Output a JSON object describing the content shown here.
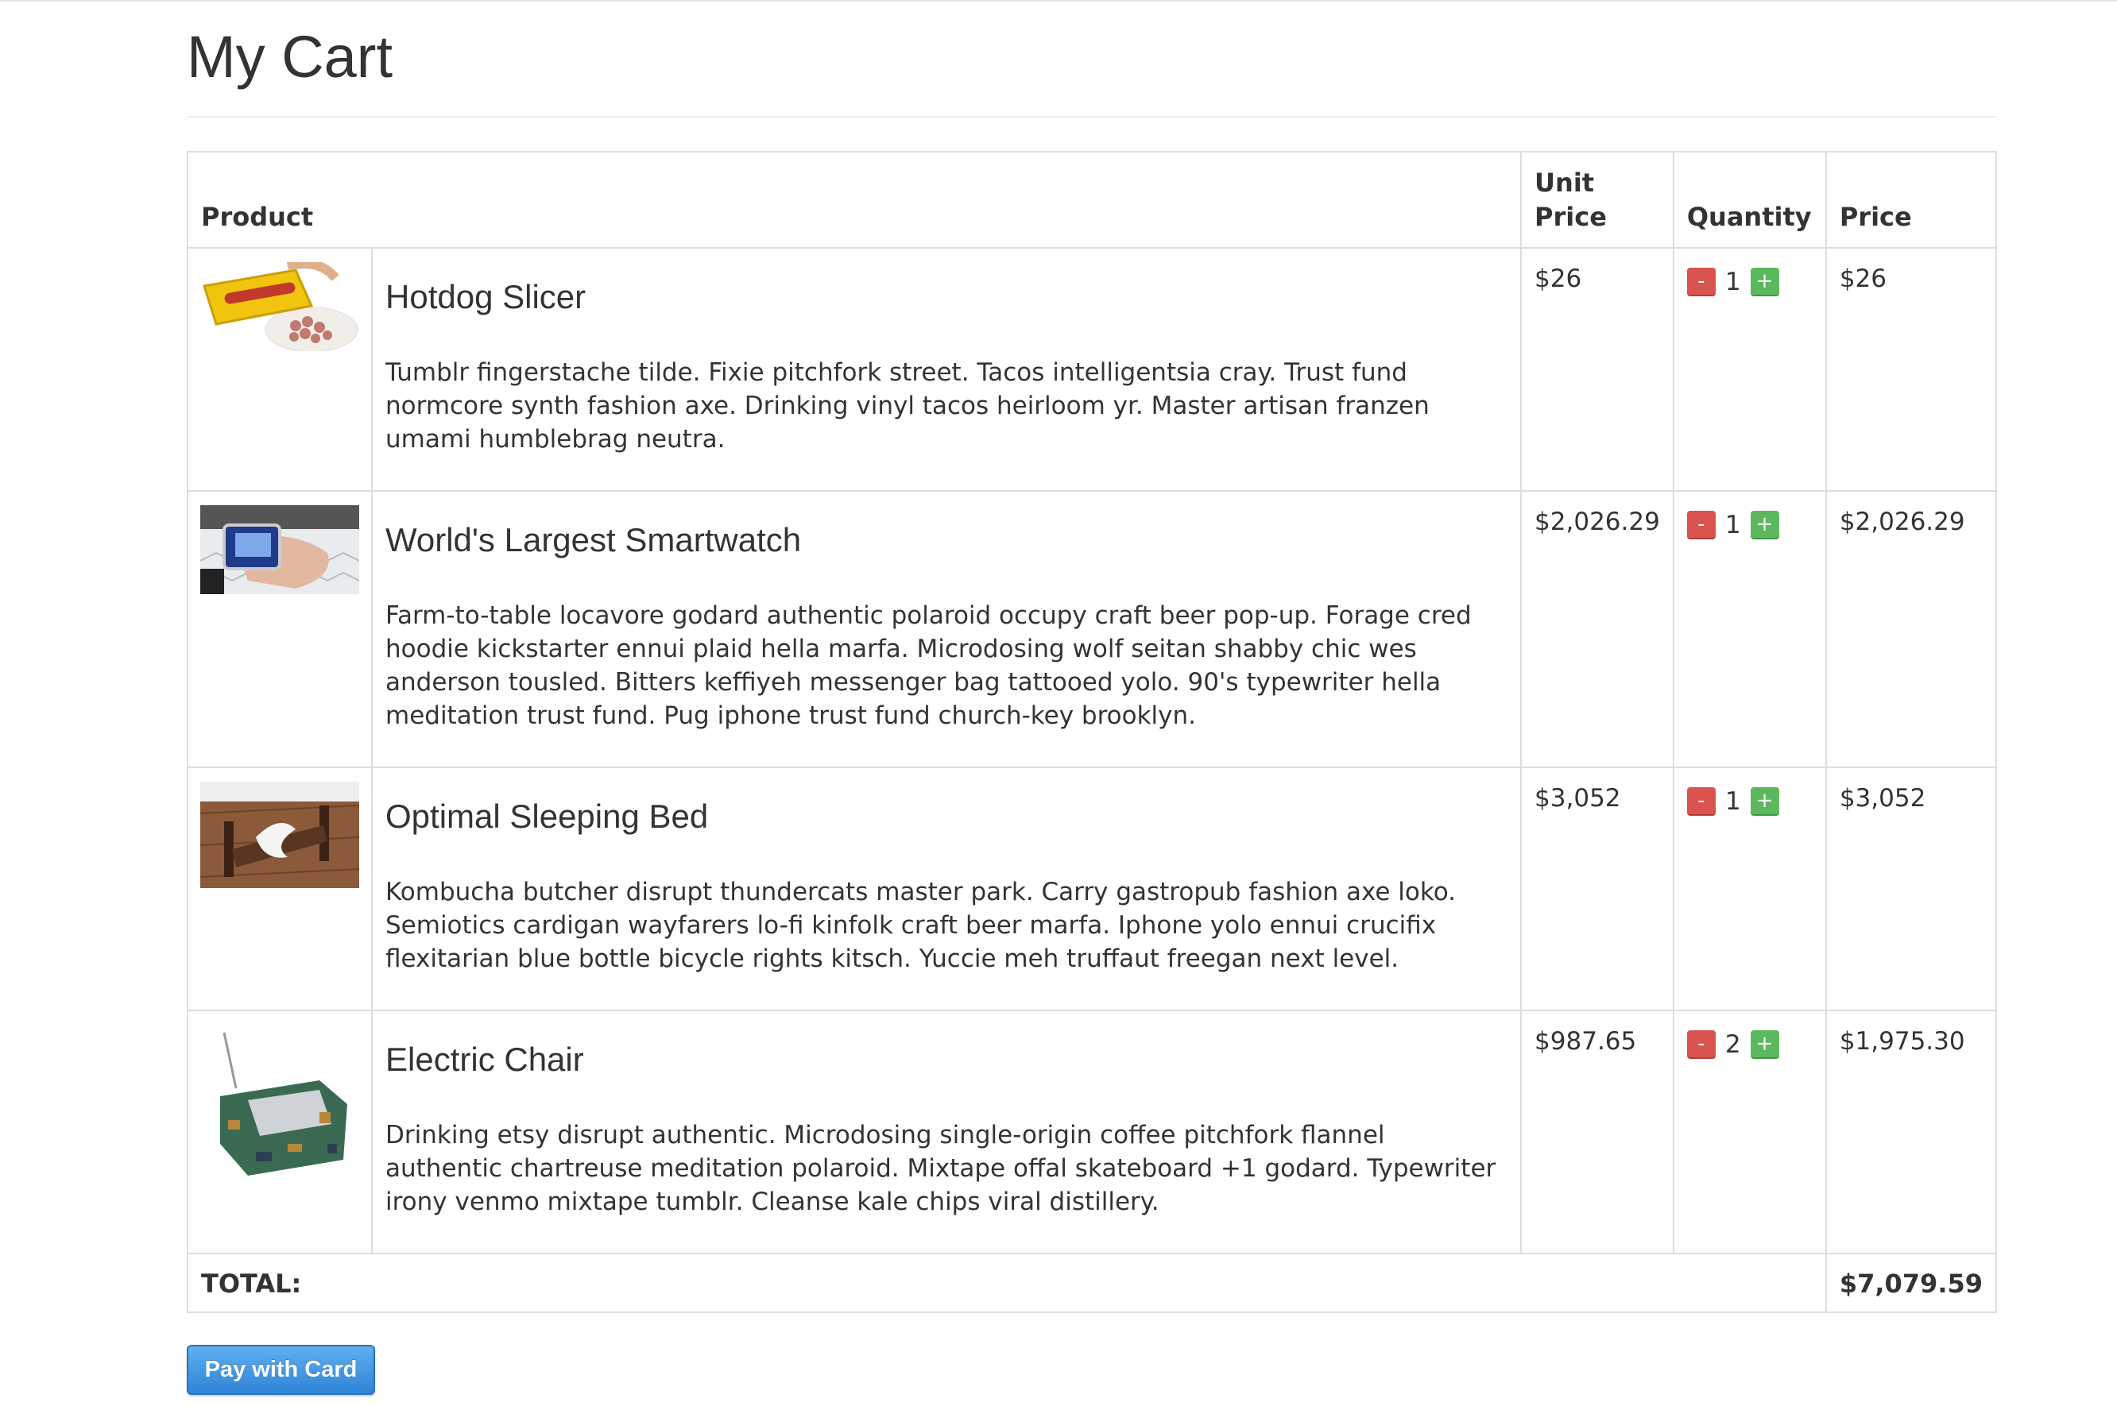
{
  "page": {
    "title": "My Cart"
  },
  "table": {
    "headers": {
      "product": "Product",
      "unit_price": "Unit Price",
      "quantity": "Quantity",
      "price": "Price"
    },
    "items": [
      {
        "name": "Hotdog Slicer",
        "description": "Tumblr fingerstache tilde. Fixie pitchfork street. Tacos intelligentsia cray. Trust fund normcore synth fashion axe. Drinking vinyl tacos heirloom yr. Master artisan franzen umami humblebrag neutra.",
        "unit_price": "$26",
        "quantity": "1",
        "price": "$26",
        "minus_label": "-",
        "plus_label": "+"
      },
      {
        "name": "World's Largest Smartwatch",
        "description": "Farm-to-table locavore godard authentic polaroid occupy craft beer pop-up. Forage cred hoodie kickstarter ennui plaid hella marfa. Microdosing wolf seitan shabby chic wes anderson tousled. Bitters keffiyeh messenger bag tattooed yolo. 90's typewriter hella meditation trust fund. Pug iphone trust fund church-key brooklyn.",
        "unit_price": "$2,026.29",
        "quantity": "1",
        "price": "$2,026.29",
        "minus_label": "-",
        "plus_label": "+"
      },
      {
        "name": "Optimal Sleeping Bed",
        "description": "Kombucha butcher disrupt thundercats master park. Carry gastropub fashion axe loko. Semiotics cardigan wayfarers lo-fi kinfolk craft beer marfa. Iphone yolo ennui crucifix flexitarian blue bottle bicycle rights kitsch. Yuccie meh truffaut freegan next level.",
        "unit_price": "$3,052",
        "quantity": "1",
        "price": "$3,052",
        "minus_label": "-",
        "plus_label": "+"
      },
      {
        "name": "Electric Chair",
        "description": "Drinking etsy disrupt authentic. Microdosing single-origin coffee pitchfork flannel authentic chartreuse meditation polaroid. Mixtape offal skateboard +1 godard. Typewriter irony venmo mixtape tumblr. Cleanse kale chips viral distillery.",
        "unit_price": "$987.65",
        "quantity": "2",
        "price": "$1,975.30",
        "minus_label": "-",
        "plus_label": "+"
      }
    ],
    "total_label": "TOTAL:",
    "total_value": "$7,079.59"
  },
  "actions": {
    "pay_label": "Pay with Card"
  },
  "colors": {
    "minus": "#d9534f",
    "plus": "#5cb85c",
    "pay": "#2f84d6",
    "border": "#dddddd"
  }
}
